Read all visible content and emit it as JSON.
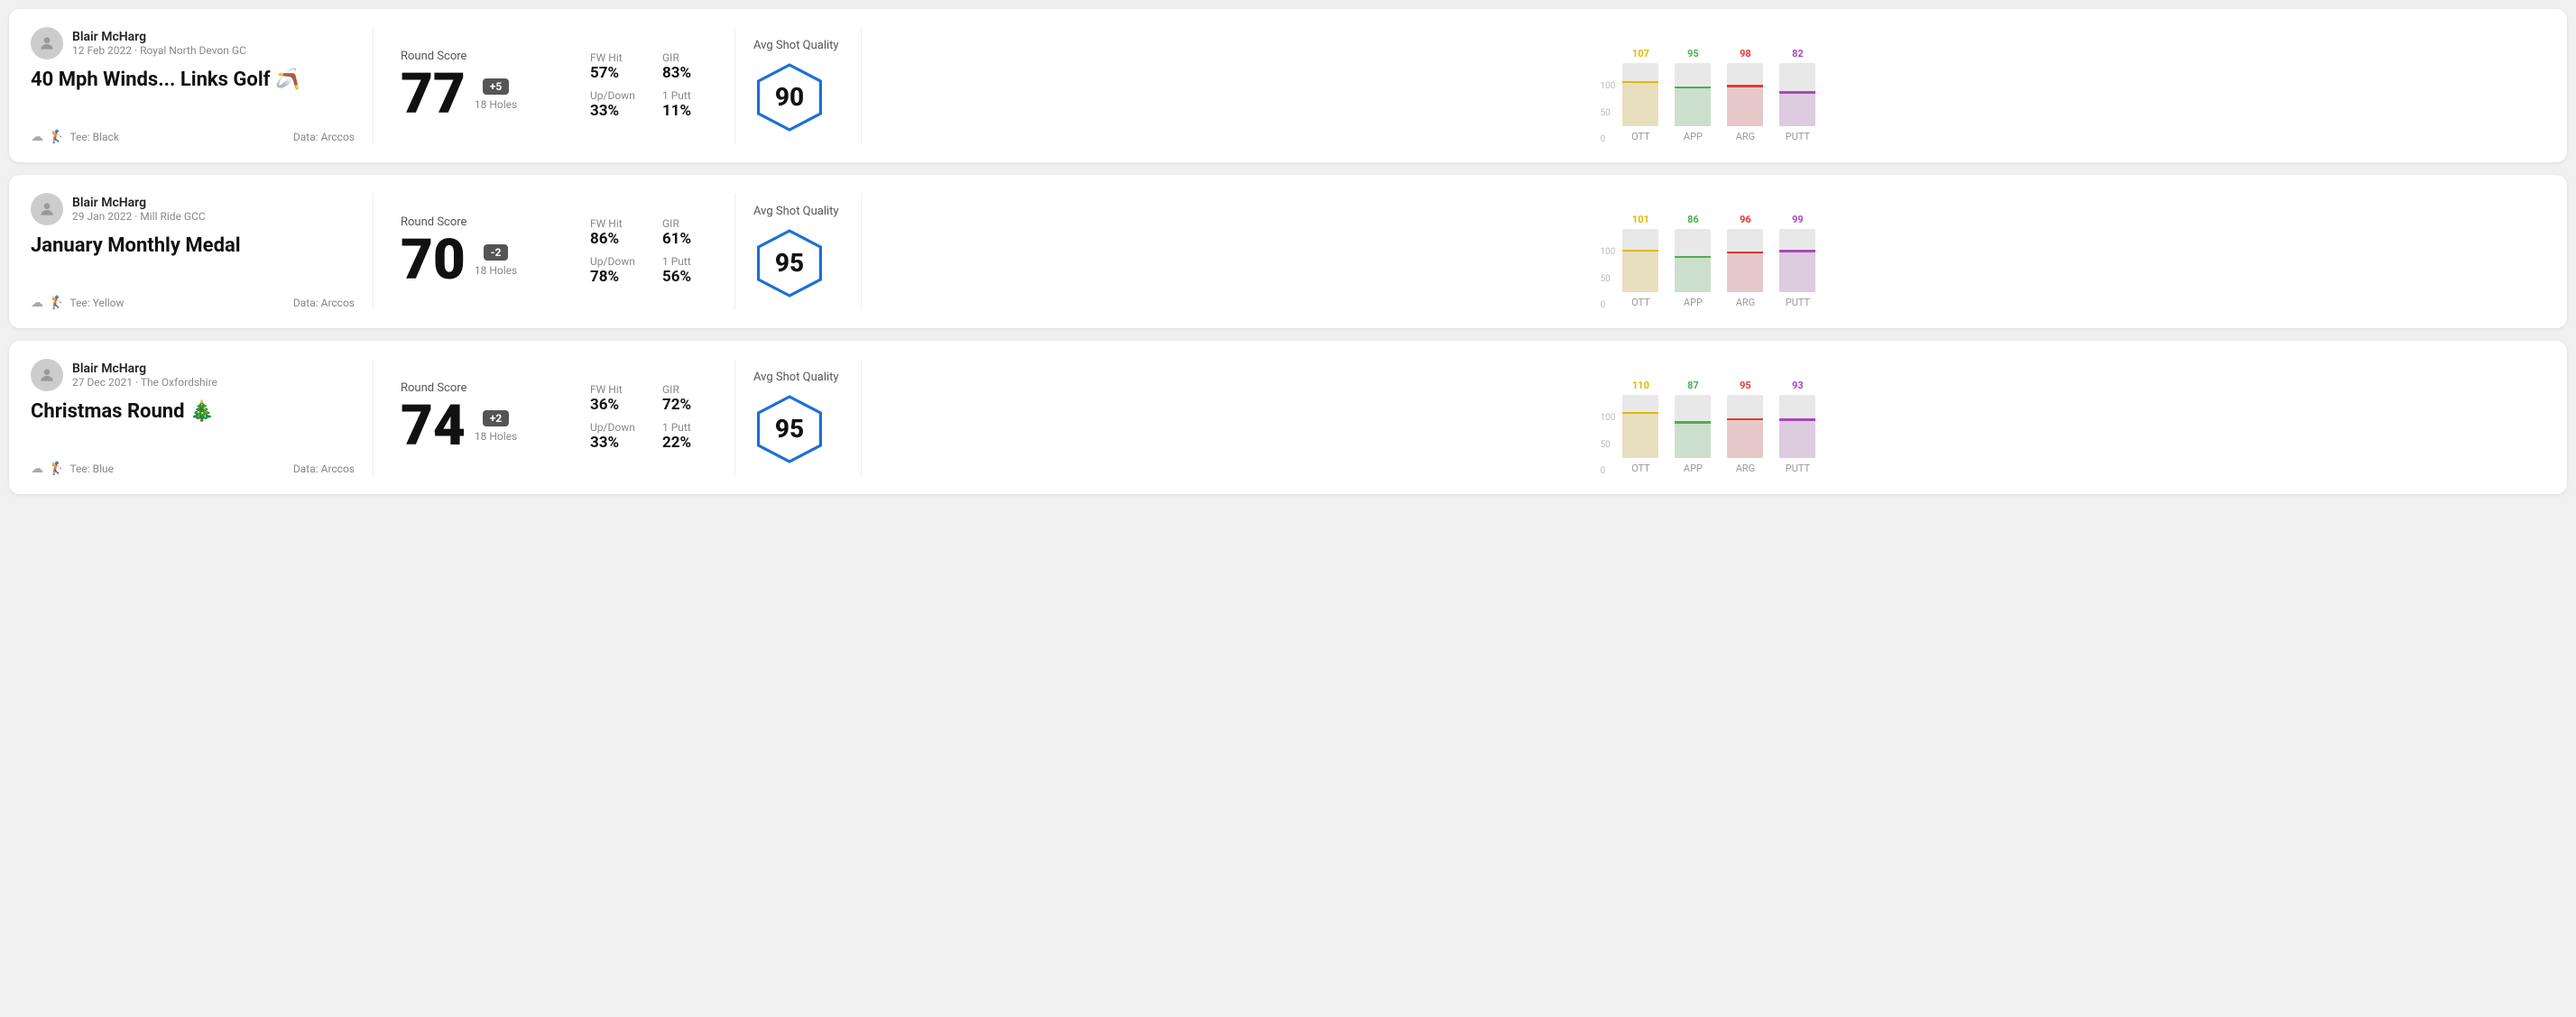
{
  "rounds": [
    {
      "id": "round1",
      "user_name": "Blair McHarg",
      "user_date": "12 Feb 2022 · Royal North Devon GC",
      "title": "40 Mph Winds... Links Golf 🪃",
      "tee": "Tee: Black",
      "data_source": "Data: Arccos",
      "round_score_label": "Round Score",
      "score": "77",
      "badge": "+5",
      "badge_type": "positive",
      "holes": "18 Holes",
      "fw_hit_label": "FW Hit",
      "fw_hit_val": "57%",
      "gir_label": "GIR",
      "gir_val": "83%",
      "updown_label": "Up/Down",
      "updown_val": "33%",
      "one_putt_label": "1 Putt",
      "one_putt_val": "11%",
      "avg_shot_quality_label": "Avg Shot Quality",
      "quality_score": "90",
      "chart": {
        "bars": [
          {
            "label": "OTT",
            "value": 107,
            "color": "#e6b800",
            "height_pct": 68
          },
          {
            "label": "APP",
            "value": 95,
            "color": "#4caf50",
            "height_pct": 60
          },
          {
            "label": "ARG",
            "value": 98,
            "color": "#e53935",
            "height_pct": 62
          },
          {
            "label": "PUTT",
            "value": 82,
            "color": "#ab47bc",
            "height_pct": 52
          }
        ],
        "y_labels": [
          "100",
          "50",
          "0"
        ]
      }
    },
    {
      "id": "round2",
      "user_name": "Blair McHarg",
      "user_date": "29 Jan 2022 · Mill Ride GCC",
      "title": "January Monthly Medal",
      "tee": "Tee: Yellow",
      "data_source": "Data: Arccos",
      "round_score_label": "Round Score",
      "score": "70",
      "badge": "-2",
      "badge_type": "negative",
      "holes": "18 Holes",
      "fw_hit_label": "FW Hit",
      "fw_hit_val": "86%",
      "gir_label": "GIR",
      "gir_val": "61%",
      "updown_label": "Up/Down",
      "updown_val": "78%",
      "one_putt_label": "1 Putt",
      "one_putt_val": "56%",
      "avg_shot_quality_label": "Avg Shot Quality",
      "quality_score": "95",
      "chart": {
        "bars": [
          {
            "label": "OTT",
            "value": 101,
            "color": "#e6b800",
            "height_pct": 64
          },
          {
            "label": "APP",
            "value": 86,
            "color": "#4caf50",
            "height_pct": 54
          },
          {
            "label": "ARG",
            "value": 96,
            "color": "#e53935",
            "height_pct": 61
          },
          {
            "label": "PUTT",
            "value": 99,
            "color": "#ab47bc",
            "height_pct": 63
          }
        ],
        "y_labels": [
          "100",
          "50",
          "0"
        ]
      }
    },
    {
      "id": "round3",
      "user_name": "Blair McHarg",
      "user_date": "27 Dec 2021 · The Oxfordshire",
      "title": "Christmas Round 🎄",
      "tee": "Tee: Blue",
      "data_source": "Data: Arccos",
      "round_score_label": "Round Score",
      "score": "74",
      "badge": "+2",
      "badge_type": "positive",
      "holes": "18 Holes",
      "fw_hit_label": "FW Hit",
      "fw_hit_val": "36%",
      "gir_label": "GIR",
      "gir_val": "72%",
      "updown_label": "Up/Down",
      "updown_val": "33%",
      "one_putt_label": "1 Putt",
      "one_putt_val": "22%",
      "avg_shot_quality_label": "Avg Shot Quality",
      "quality_score": "95",
      "chart": {
        "bars": [
          {
            "label": "OTT",
            "value": 110,
            "color": "#e6b800",
            "height_pct": 70
          },
          {
            "label": "APP",
            "value": 87,
            "color": "#4caf50",
            "height_pct": 55
          },
          {
            "label": "ARG",
            "value": 95,
            "color": "#e53935",
            "height_pct": 60
          },
          {
            "label": "PUTT",
            "value": 93,
            "color": "#ab47bc",
            "height_pct": 59
          }
        ],
        "y_labels": [
          "100",
          "50",
          "0"
        ]
      }
    }
  ]
}
